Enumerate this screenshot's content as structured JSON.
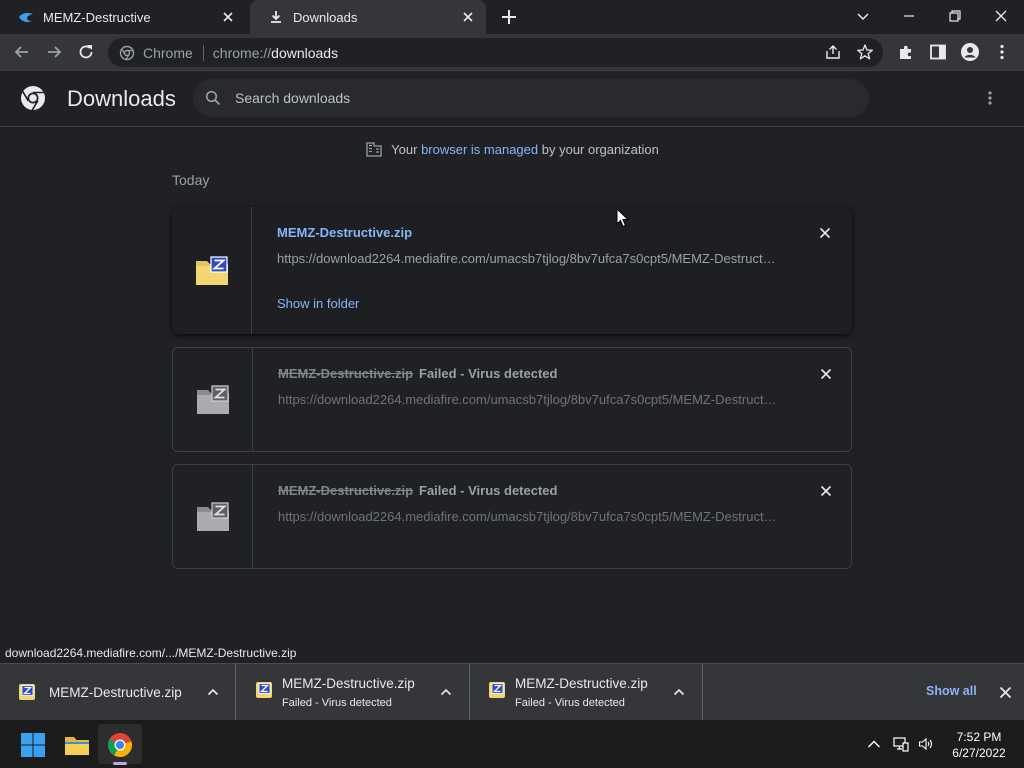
{
  "tabs": [
    {
      "title": "MEMZ-Destructive",
      "active": false
    },
    {
      "title": "Downloads",
      "active": true
    }
  ],
  "omnibox": {
    "chip": "Chrome",
    "scheme": "chrome://",
    "host": "downloads"
  },
  "page": {
    "title": "Downloads",
    "search_placeholder": "Search downloads",
    "managed": {
      "prefix": "Your",
      "link": "browser is managed",
      "suffix": "by your organization"
    },
    "day_label": "Today"
  },
  "downloads": [
    {
      "name": "MEMZ-Destructive.zip",
      "status": "",
      "url": "https://download2264.mediafire.com/umacsb7tjlog/8bv7ufca7s0cpt5/MEMZ-Destructive.zip",
      "action": "Show in folder"
    },
    {
      "name": "MEMZ-Destructive.zip",
      "status": "Failed - Virus detected",
      "url": "https://download2264.mediafire.com/umacsb7tjlog/8bv7ufca7s0cpt5/MEMZ-Destructive.zip"
    },
    {
      "name": "MEMZ-Destructive.zip",
      "status": "Failed - Virus detected",
      "url": "https://download2264.mediafire.com/umacsb7tjlog/8bv7ufca7s0cpt5/MEMZ-Destructive.zip"
    }
  ],
  "status_bubble": "download2264.mediafire.com/.../MEMZ-Destructive.zip",
  "shelf": {
    "items": [
      {
        "name": "MEMZ-Destructive.zip",
        "status": ""
      },
      {
        "name": "MEMZ-Destructive.zip",
        "status": "Failed - Virus detected"
      },
      {
        "name": "MEMZ-Destructive.zip",
        "status": "Failed - Virus detected"
      }
    ],
    "show_all": "Show all"
  },
  "taskbar": {
    "time": "7:52 PM",
    "date": "6/27/2022"
  },
  "colors": {
    "accent": "#8ab4f8",
    "background": "#202124",
    "toolbar": "#35363a",
    "taskbar": "#1c1c1c"
  }
}
